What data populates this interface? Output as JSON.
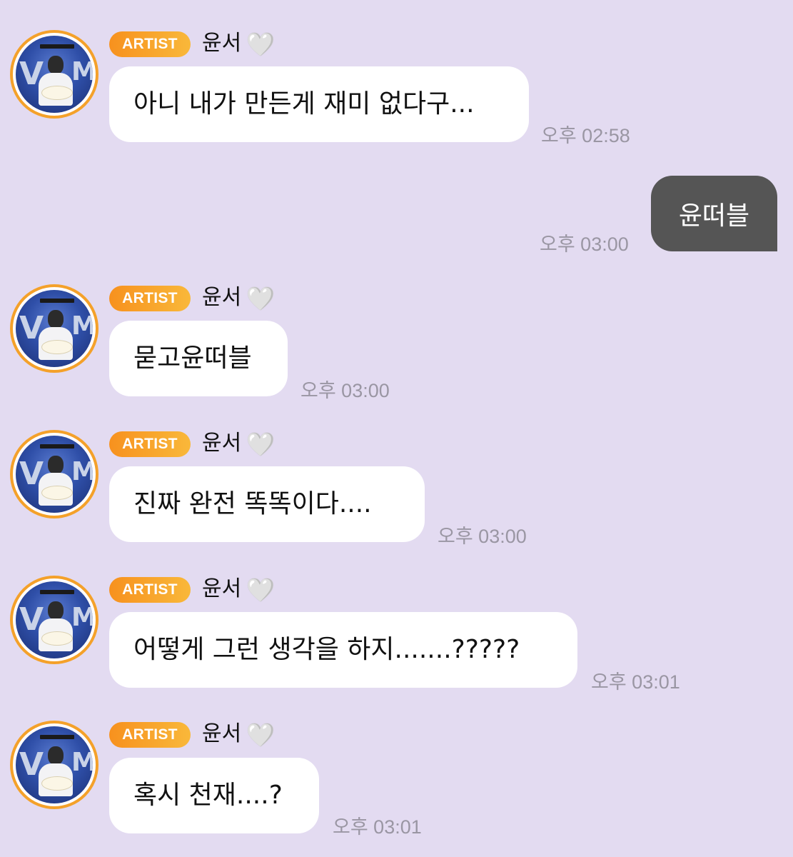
{
  "messages": [
    {
      "badge": "ARTIST",
      "sender": "윤서",
      "heart": "🤍",
      "text": "아니 내가 만든게 재미 없다구...",
      "time": "오후 02:58"
    },
    {
      "badge": "ARTIST",
      "sender": "윤서",
      "heart": "🤍",
      "text": "묻고윤떠블",
      "time": "오후 03:00"
    },
    {
      "badge": "ARTIST",
      "sender": "윤서",
      "heart": "🤍",
      "text": "진짜 완전 똑똑이다....",
      "time": "오후 03:00"
    },
    {
      "badge": "ARTIST",
      "sender": "윤서",
      "heart": "🤍",
      "text": "어떻게 그런 생각을 하지.......?????",
      "time": "오후 03:01"
    },
    {
      "badge": "ARTIST",
      "sender": "윤서",
      "heart": "🤍",
      "text": "혹시 천재....?",
      "time": "오후 03:01"
    }
  ],
  "outgoing": {
    "text": "윤떠블",
    "time": "오후 03:00"
  },
  "colors": {
    "background": "#e3dbf1",
    "badge_start": "#f7911e",
    "badge_end": "#f9b83a",
    "outgoing_bubble": "#555555",
    "avatar_ring": "#f4a12a"
  }
}
